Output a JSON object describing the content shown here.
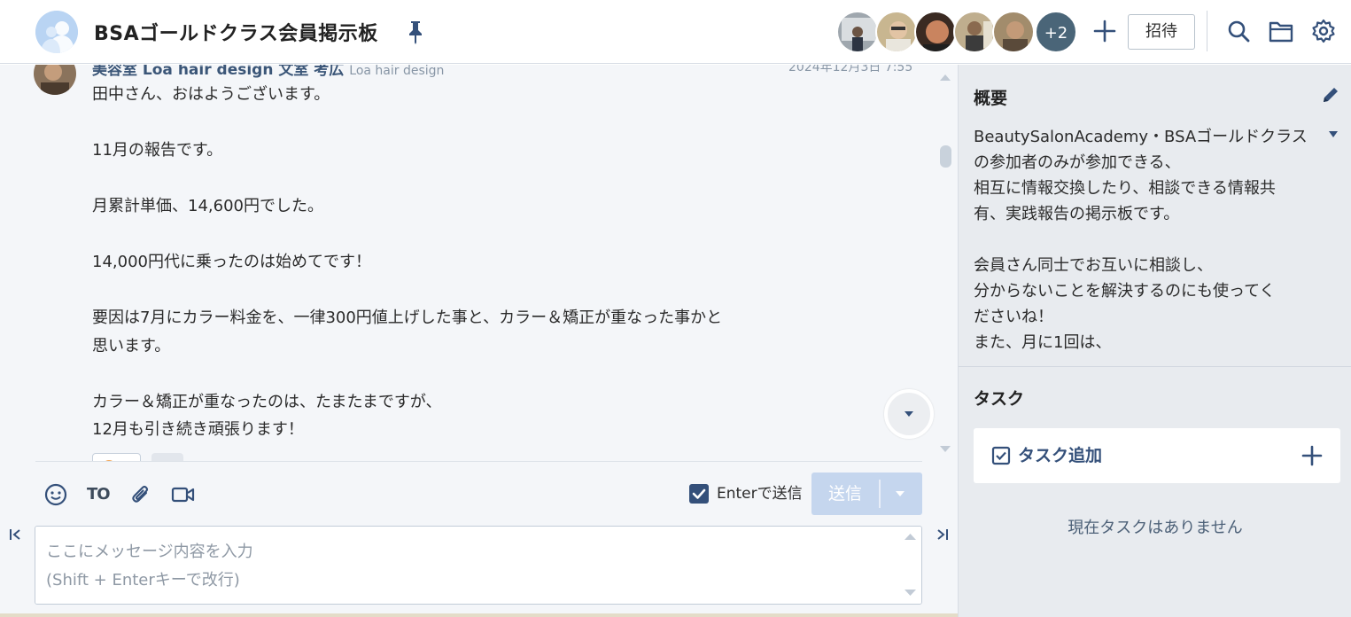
{
  "header": {
    "room_title": "BSAゴールドクラス会員掲示板",
    "more_members_count": "+2",
    "invite_label": "招待",
    "icons": [
      "room-avatar-icon",
      "pin-icon",
      "plus-icon",
      "search-icon",
      "folder-icon",
      "gear-icon"
    ]
  },
  "message": {
    "sender": "美容室 Loa hair design 文室 考広",
    "org": "Loa hair design",
    "time": "2024年12月3日 7:55",
    "lines": [
      "田中さん、おはようございます。",
      "",
      "11月の報告です。",
      "",
      "月累計単価、14,600円でした。",
      "",
      "14,000円代に乗ったのは始めてです！",
      "",
      "要因は7月にカラー料金を、一律300円値上げした事と、カラー＆矯正が重なった事かと",
      "思います。",
      "",
      "カラー＆矯正が重なったのは、たまたまですが、",
      "12月も引き続き頑張ります！"
    ]
  },
  "composer": {
    "to_label": "TO",
    "enter_to_send_label": "Enterで送信",
    "enter_to_send_checked": true,
    "send_label": "送信",
    "input_placeholder": "ここにメッセージ内容を入力\n(Shift + Enterキーで改行)",
    "input_value": ""
  },
  "side": {
    "overview_title": "概要",
    "overview_lines": [
      "BeautySalonAcademy・BSAゴールドクラス",
      "の参加者のみが参加できる、",
      "相互に情報交換したり、相談できる情報共",
      "有、実践報告の掲示板です。",
      "",
      "会員さん同士でお互いに相談し、",
      "分からないことを解決するのにも使ってく",
      "ださいね！",
      "また、月に1回は、"
    ],
    "task_title": "タスク",
    "task_add_label": "タスク追加",
    "no_task_label": "現在タスクはありません"
  },
  "colors": {
    "accent": "#34507a",
    "send_disabled": "#c5d6ee",
    "side_bg": "#e8ebef",
    "chat_bg": "#f4f6f9",
    "member_more_bg": "#4a6578"
  }
}
